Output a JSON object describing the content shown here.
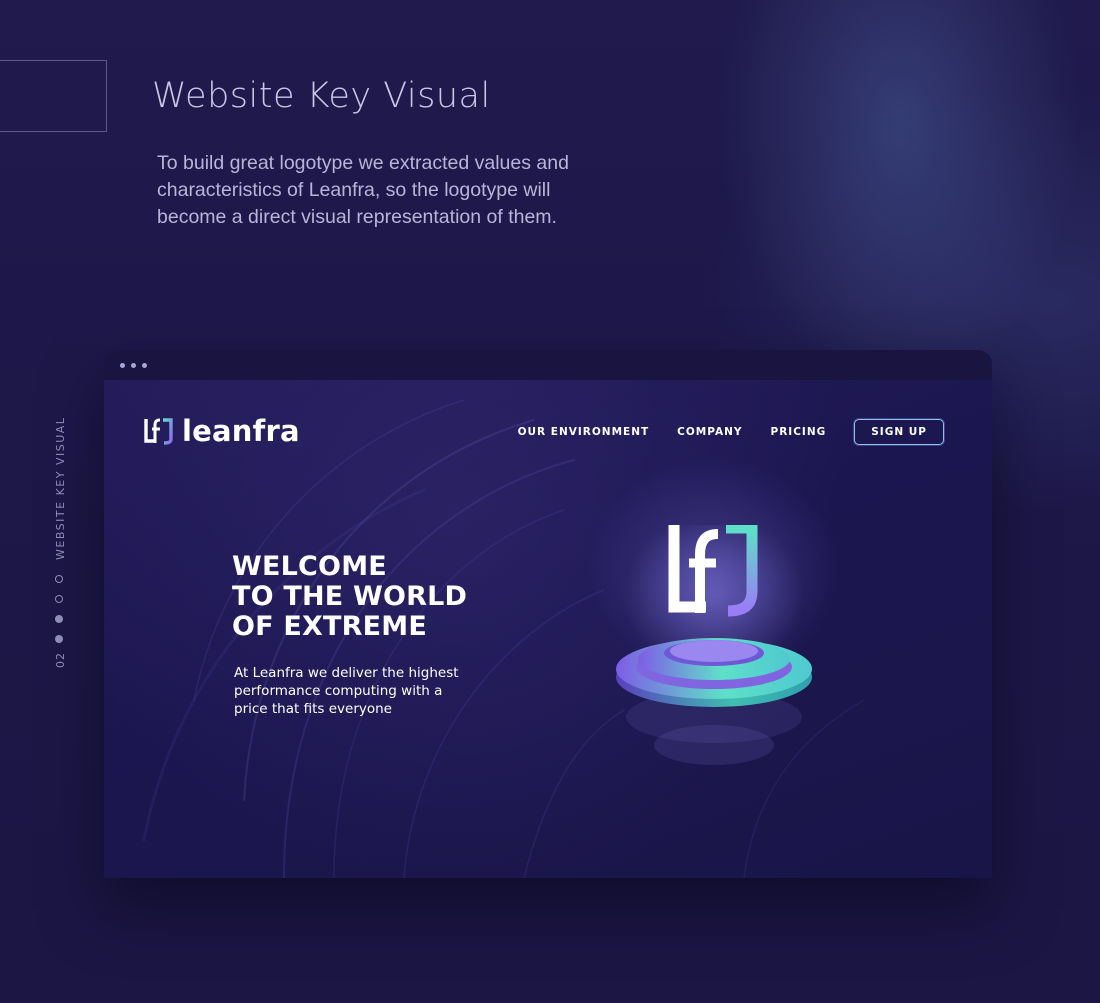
{
  "presentation": {
    "title": "Website Key Visual",
    "description": "To build great logotype we extracted values and characteristics of Leanfra, so the logotype will become a direct visual representation of them.",
    "side_label": "WEBSITE KEY VISUAL",
    "side_index": "02"
  },
  "site": {
    "brand": "leanfra",
    "nav": {
      "environment": "OUR ENVIRONMENT",
      "company": "COMPANY",
      "pricing": "PRICING",
      "signup": "SIGN UP"
    },
    "hero": {
      "line1": "WELCOME",
      "line2": "TO THE WORLD",
      "line3": "OF EXTREME",
      "subtitle": "At Leanfra we deliver the highest performance computing with a price that fits everyone"
    }
  },
  "colors": {
    "background": "#1e1848",
    "accent_teal": "#5ee0c8",
    "accent_violet": "#8b6cf0"
  },
  "icons": [
    "leanfra-logo-icon",
    "pedestal-logo-icon"
  ]
}
